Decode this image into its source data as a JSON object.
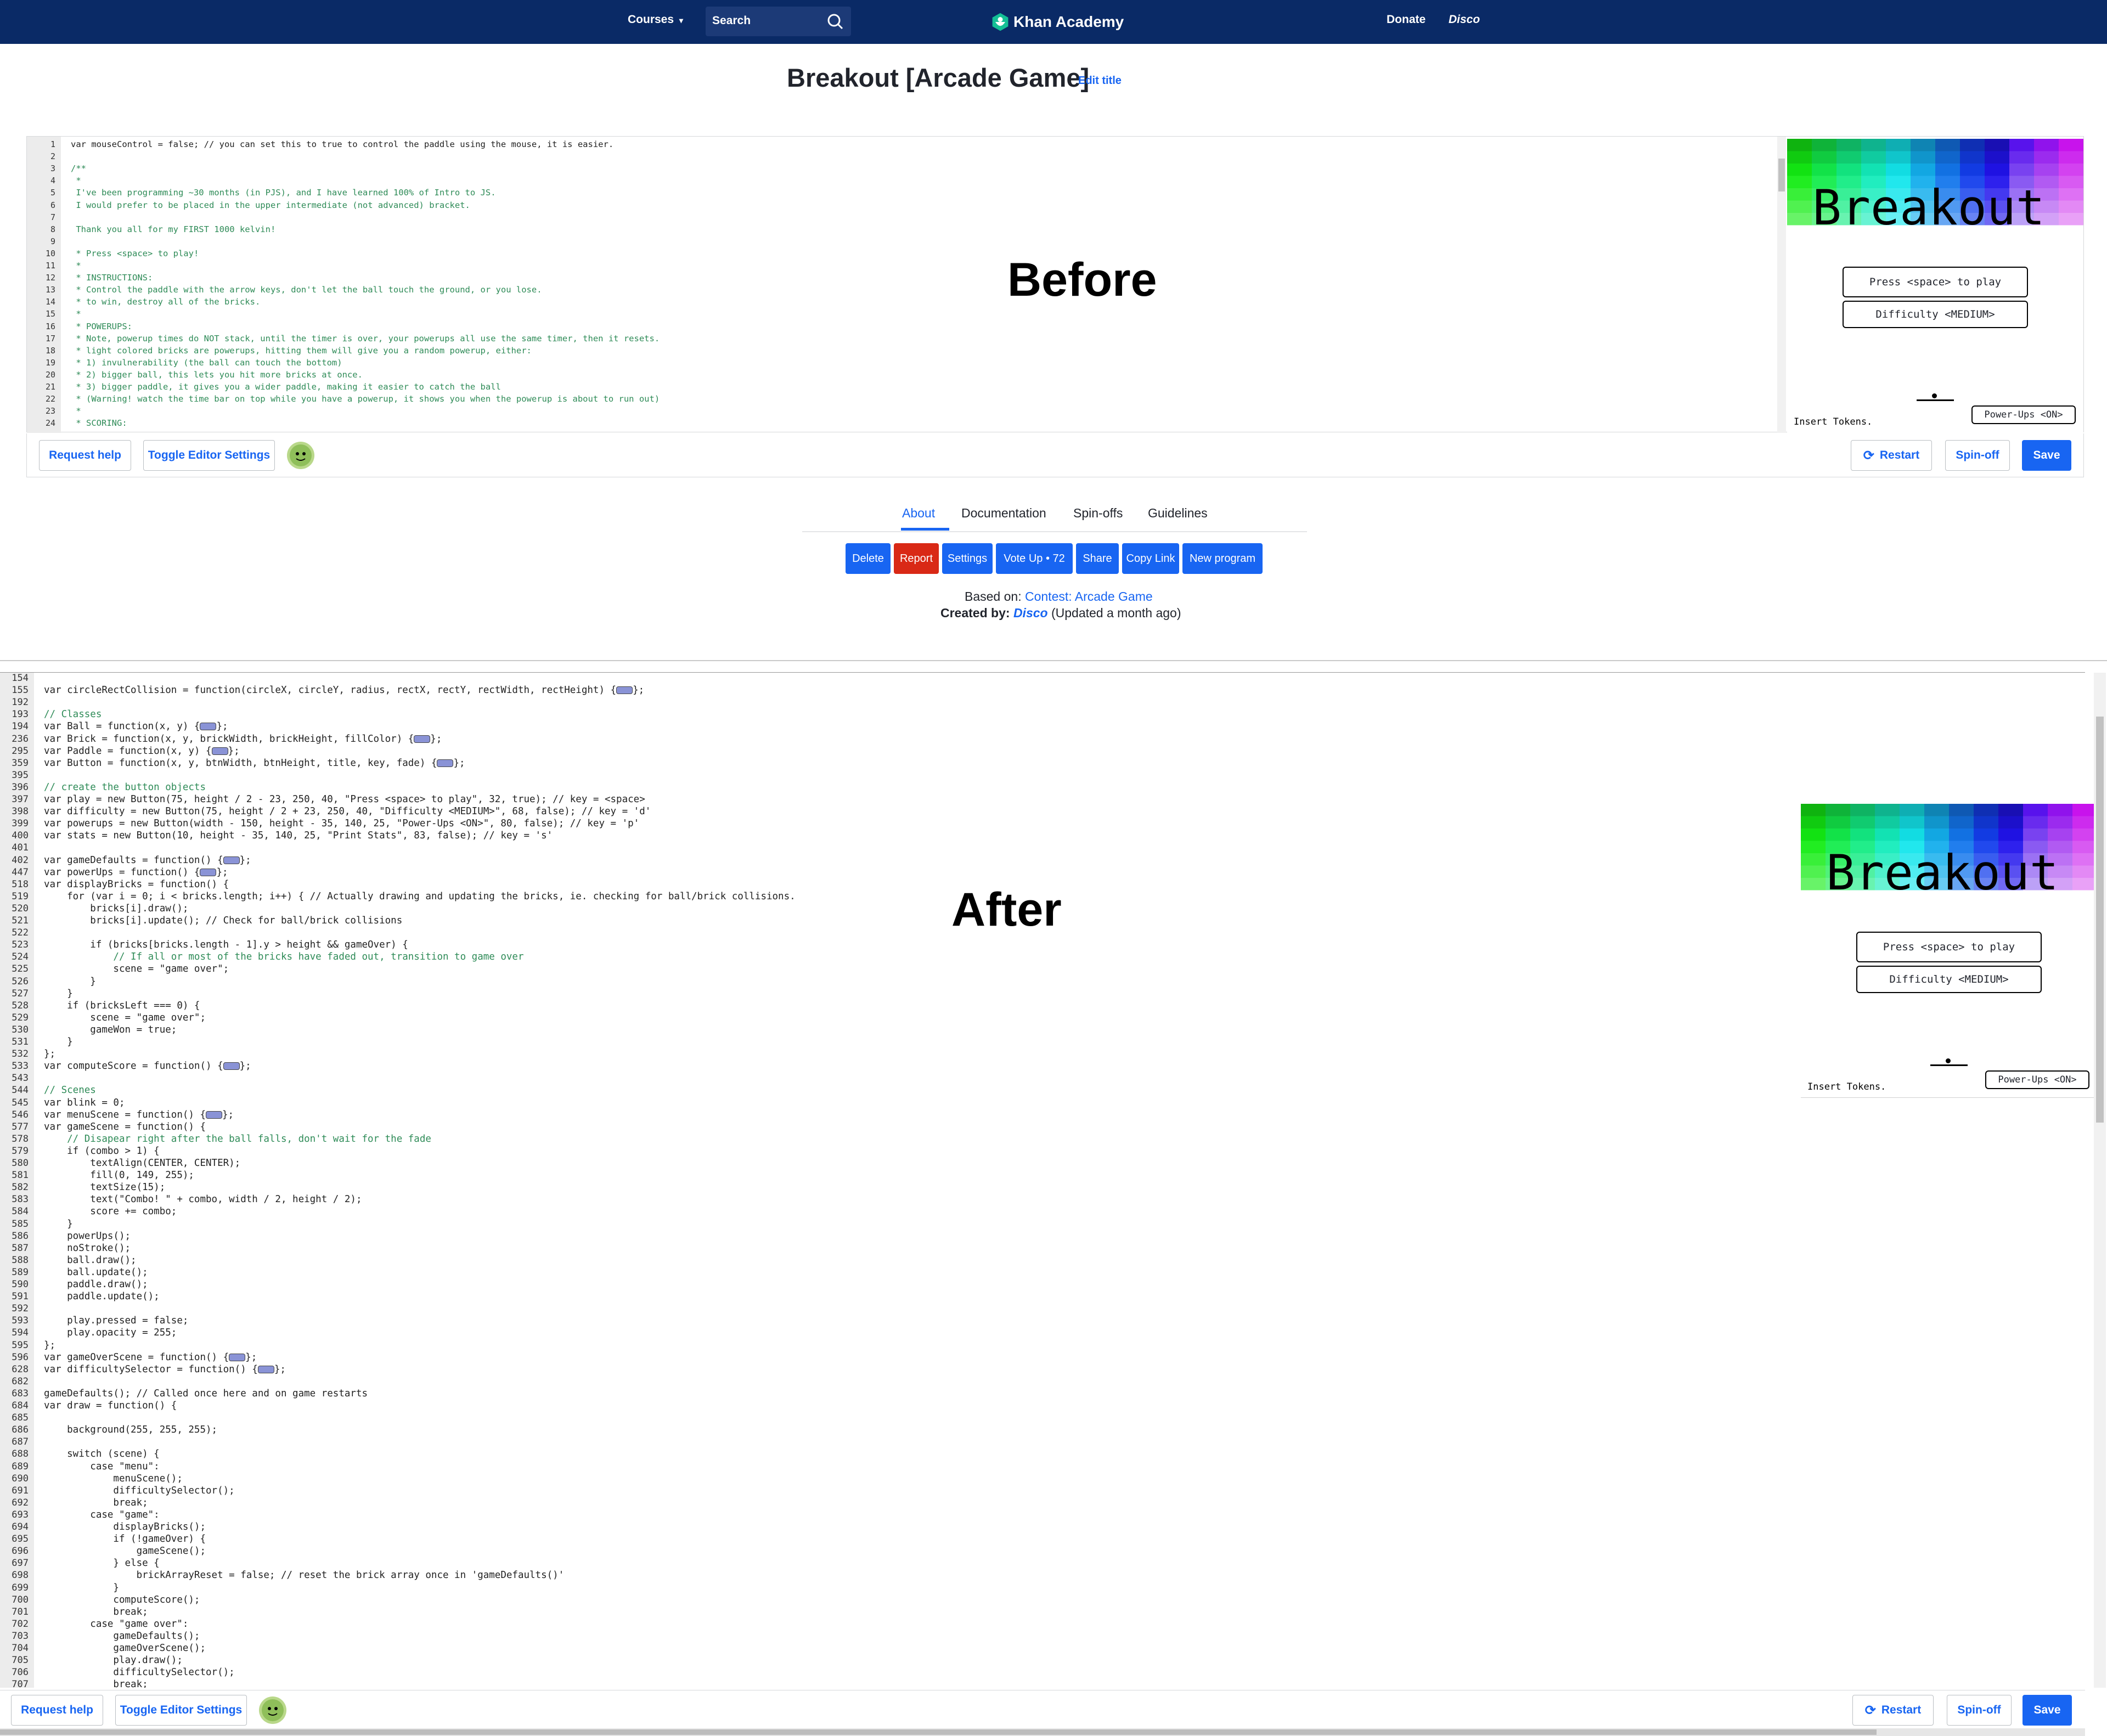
{
  "nav": {
    "courses": "Courses",
    "search_placeholder": "Search",
    "logo": "Khan Academy",
    "donate": "Donate",
    "user": "Disco"
  },
  "page": {
    "title": "Breakout [Arcade Game]",
    "edit_title": "Edit title"
  },
  "editor_top": {
    "overlay_label": "Before",
    "lines": [
      {
        "n": "1",
        "t": "var mouseControl = false; // you can set this to true to control the paddle using the mouse, it is easier."
      },
      {
        "n": "2",
        "t": ""
      },
      {
        "n": "3",
        "t": "/**"
      },
      {
        "n": "4",
        "t": " *"
      },
      {
        "n": "5",
        "t": " I've been programming ~30 months (in PJS), and I have learned 100% of Intro to JS."
      },
      {
        "n": "6",
        "t": " I would prefer to be placed in the upper intermediate (not advanced) bracket."
      },
      {
        "n": "7",
        "t": ""
      },
      {
        "n": "8",
        "t": " Thank you all for my FIRST 1000 kelvin!"
      },
      {
        "n": "9",
        "t": ""
      },
      {
        "n": "10",
        "t": " * Press <space> to play!"
      },
      {
        "n": "11",
        "t": " *"
      },
      {
        "n": "12",
        "t": " * INSTRUCTIONS:"
      },
      {
        "n": "13",
        "t": " * Control the paddle with the arrow keys, don't let the ball touch the ground, or you lose."
      },
      {
        "n": "14",
        "t": " * to win, destroy all of the bricks."
      },
      {
        "n": "15",
        "t": " *"
      },
      {
        "n": "16",
        "t": " * POWERUPS:"
      },
      {
        "n": "17",
        "t": " * Note, powerup times do NOT stack, until the timer is over, your powerups all use the same timer, then it resets."
      },
      {
        "n": "18",
        "t": " * light colored bricks are powerups, hitting them will give you a random powerup, either:"
      },
      {
        "n": "19",
        "t": " * 1) invulnerability (the ball can touch the bottom)"
      },
      {
        "n": "20",
        "t": " * 2) bigger ball, this lets you hit more bricks at once."
      },
      {
        "n": "21",
        "t": " * 3) bigger paddle, it gives you a wider paddle, making it easier to catch the ball"
      },
      {
        "n": "22",
        "t": " * (Warning! watch the time bar on top while you have a powerup, it shows you when the powerup is about to run out)"
      },
      {
        "n": "23",
        "t": " *"
      },
      {
        "n": "24",
        "t": " * SCORING:"
      }
    ]
  },
  "game": {
    "logo": "Breakout",
    "play_button": "Press <space> to play",
    "difficulty_button": "Difficulty <MEDIUM>",
    "insert_tokens": "Insert Tokens.",
    "powerups_button": "Power-Ups <ON>"
  },
  "toolbar": {
    "request_help": "Request help",
    "toggle_settings": "Toggle Editor Settings",
    "restart": "Restart",
    "spinoff": "Spin-off",
    "save": "Save"
  },
  "tabs": [
    "About",
    "Documentation",
    "Spin-offs",
    "Guidelines"
  ],
  "actions": [
    "Delete",
    "Report",
    "Settings",
    "Vote Up • 72",
    "Share",
    "Copy Link",
    "New program"
  ],
  "meta": {
    "based_on_label": "Based on:",
    "based_on_link": "Contest: Arcade Game",
    "created_by_label": "Created by:",
    "created_by_user": "Disco",
    "updated": "(Updated a month ago)"
  },
  "editor_bottom": {
    "overlay_label": "After",
    "lines": [
      {
        "n": "154",
        "t": ""
      },
      {
        "n": "155",
        "t": "var circleRectCollision = function(circleX, circleY, radius, rectX, rectY, rectWidth, rectHeight) {[]};"
      },
      {
        "n": "192",
        "t": ""
      },
      {
        "n": "193",
        "t": "// Classes"
      },
      {
        "n": "194",
        "t": "var Ball = function(x, y) {[]};"
      },
      {
        "n": "236",
        "t": "var Brick = function(x, y, brickWidth, brickHeight, fillColor) {[]};"
      },
      {
        "n": "295",
        "t": "var Paddle = function(x, y) {[]};"
      },
      {
        "n": "359",
        "t": "var Button = function(x, y, btnWidth, btnHeight, title, key, fade) {[]};"
      },
      {
        "n": "395",
        "t": ""
      },
      {
        "n": "396",
        "t": "// create the button objects"
      },
      {
        "n": "397",
        "t": "var play = new Button(75, height / 2 - 23, 250, 40, \"Press <space> to play\", 32, true); // key = <space>"
      },
      {
        "n": "398",
        "t": "var difficulty = new Button(75, height / 2 + 23, 250, 40, \"Difficulty <MEDIUM>\", 68, false); // key = 'd'"
      },
      {
        "n": "399",
        "t": "var powerups = new Button(width - 150, height - 35, 140, 25, \"Power-Ups <ON>\", 80, false); // key = 'p'"
      },
      {
        "n": "400",
        "t": "var stats = new Button(10, height - 35, 140, 25, \"Print Stats\", 83, false); // key = 's'"
      },
      {
        "n": "401",
        "t": ""
      },
      {
        "n": "402",
        "t": "var gameDefaults = function() {[]};"
      },
      {
        "n": "447",
        "t": "var powerUps = function() {[]};"
      },
      {
        "n": "518",
        "t": "var displayBricks = function() {"
      },
      {
        "n": "519",
        "t": "    for (var i = 0; i < bricks.length; i++) { // Actually drawing and updating the bricks, ie. checking for ball/brick collisions."
      },
      {
        "n": "520",
        "t": "        bricks[i].draw();"
      },
      {
        "n": "521",
        "t": "        bricks[i].update(); // Check for ball/brick collisions"
      },
      {
        "n": "522",
        "t": ""
      },
      {
        "n": "523",
        "t": "        if (bricks[bricks.length - 1].y > height && gameOver) {"
      },
      {
        "n": "524",
        "t": "            // If all or most of the bricks have faded out, transition to game over"
      },
      {
        "n": "525",
        "t": "            scene = \"game over\";"
      },
      {
        "n": "526",
        "t": "        }"
      },
      {
        "n": "527",
        "t": "    }"
      },
      {
        "n": "528",
        "t": "    if (bricksLeft === 0) {"
      },
      {
        "n": "529",
        "t": "        scene = \"game over\";"
      },
      {
        "n": "530",
        "t": "        gameWon = true;"
      },
      {
        "n": "531",
        "t": "    }"
      },
      {
        "n": "532",
        "t": "};"
      },
      {
        "n": "533",
        "t": "var computeScore = function() {[]};"
      },
      {
        "n": "543",
        "t": ""
      },
      {
        "n": "544",
        "t": "// Scenes"
      },
      {
        "n": "545",
        "t": "var blink = 0;"
      },
      {
        "n": "546",
        "t": "var menuScene = function() {[]};"
      },
      {
        "n": "577",
        "t": "var gameScene = function() {"
      },
      {
        "n": "578",
        "t": "    // Disapear right after the ball falls, don't wait for the fade"
      },
      {
        "n": "579",
        "t": "    if (combo > 1) {"
      },
      {
        "n": "580",
        "t": "        textAlign(CENTER, CENTER);"
      },
      {
        "n": "581",
        "t": "        fill(0, 149, 255);"
      },
      {
        "n": "582",
        "t": "        textSize(15);"
      },
      {
        "n": "583",
        "t": "        text(\"Combo! \" + combo, width / 2, height / 2);"
      },
      {
        "n": "584",
        "t": "        score += combo;"
      },
      {
        "n": "585",
        "t": "    }"
      },
      {
        "n": "586",
        "t": "    powerUps();"
      },
      {
        "n": "587",
        "t": "    noStroke();"
      },
      {
        "n": "588",
        "t": "    ball.draw();"
      },
      {
        "n": "589",
        "t": "    ball.update();"
      },
      {
        "n": "590",
        "t": "    paddle.draw();"
      },
      {
        "n": "591",
        "t": "    paddle.update();"
      },
      {
        "n": "592",
        "t": ""
      },
      {
        "n": "593",
        "t": "    play.pressed = false;"
      },
      {
        "n": "594",
        "t": "    play.opacity = 255;"
      },
      {
        "n": "595",
        "t": "};"
      },
      {
        "n": "596",
        "t": "var gameOverScene = function() {[]};"
      },
      {
        "n": "628",
        "t": "var difficultySelector = function() {[]};"
      },
      {
        "n": "682",
        "t": ""
      },
      {
        "n": "683",
        "t": "gameDefaults(); // Called once here and on game restarts"
      },
      {
        "n": "684",
        "t": "var draw = function() {"
      },
      {
        "n": "685",
        "t": ""
      },
      {
        "n": "686",
        "t": "    background(255, 255, 255);"
      },
      {
        "n": "687",
        "t": ""
      },
      {
        "n": "688",
        "t": "    switch (scene) {"
      },
      {
        "n": "689",
        "t": "        case \"menu\":"
      },
      {
        "n": "690",
        "t": "            menuScene();"
      },
      {
        "n": "691",
        "t": "            difficultySelector();"
      },
      {
        "n": "692",
        "t": "            break;"
      },
      {
        "n": "693",
        "t": "        case \"game\":"
      },
      {
        "n": "694",
        "t": "            displayBricks();"
      },
      {
        "n": "695",
        "t": "            if (!gameOver) {"
      },
      {
        "n": "696",
        "t": "                gameScene();"
      },
      {
        "n": "697",
        "t": "            } else {"
      },
      {
        "n": "698",
        "t": "                brickArrayReset = false; // reset the brick array once in 'gameDefaults()'"
      },
      {
        "n": "699",
        "t": "            }"
      },
      {
        "n": "700",
        "t": "            computeScore();"
      },
      {
        "n": "701",
        "t": "            break;"
      },
      {
        "n": "702",
        "t": "        case \"game over\":"
      },
      {
        "n": "703",
        "t": "            gameDefaults();"
      },
      {
        "n": "704",
        "t": "            gameOverScene();"
      },
      {
        "n": "705",
        "t": "            play.draw();"
      },
      {
        "n": "706",
        "t": "            difficultySelector();"
      },
      {
        "n": "707",
        "t": "            break;"
      }
    ]
  },
  "colors": {
    "nav_bg": "#0a2a66",
    "accent": "#1865f2",
    "danger": "#d92916"
  }
}
